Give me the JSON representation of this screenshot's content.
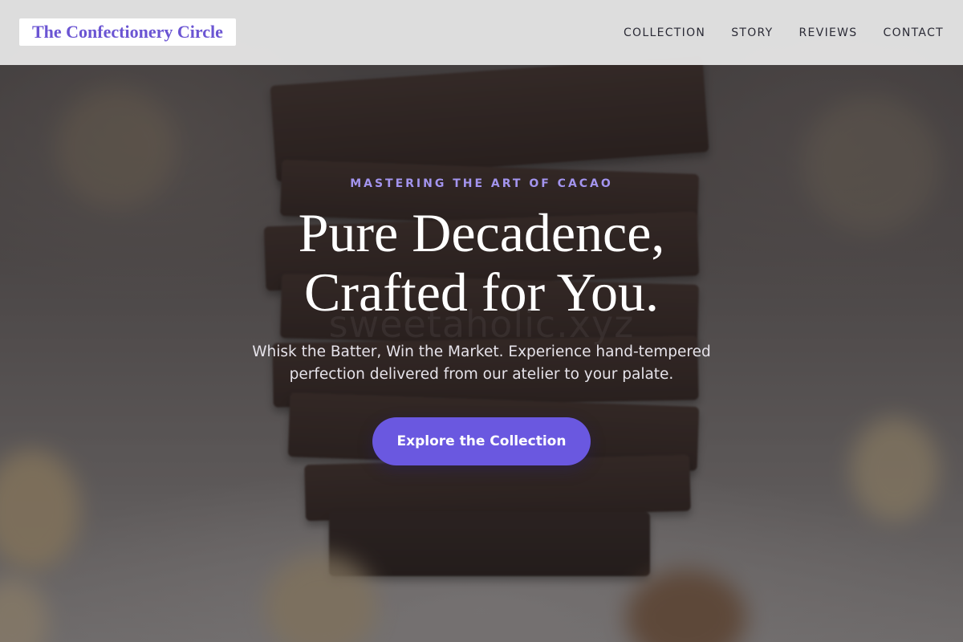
{
  "header": {
    "logo": "The Confectionery Circle",
    "nav": [
      {
        "label": "COLLECTION"
      },
      {
        "label": "STORY"
      },
      {
        "label": "REVIEWS"
      },
      {
        "label": "CONTACT"
      }
    ]
  },
  "hero": {
    "eyebrow": "MASTERING THE ART OF CACAO",
    "headline_line1": "Pure Decadence,",
    "headline_line2": "Crafted for You.",
    "watermark": "sweetaholic.xyz",
    "subtext": "Whisk the Batter, Win the Market. Experience hand-tempered perfection delivered from our atelier to your palate.",
    "cta_label": "Explore the Collection"
  },
  "colors": {
    "accent": "#6a58e0",
    "logo_text": "#6b55d3",
    "eyebrow": "#a394ee",
    "header_bg": "#e4e4e4"
  }
}
